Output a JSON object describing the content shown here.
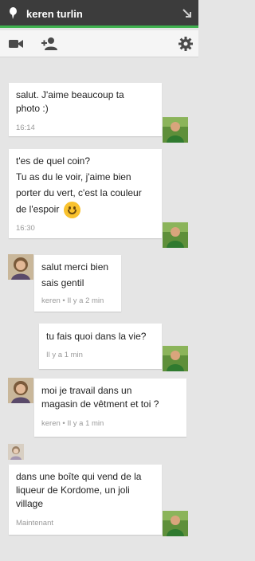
{
  "header": {
    "contact_name": "keren turlin"
  },
  "toolbar": {
    "video_icon": "video-camera-icon",
    "add_icon": "add-person-icon",
    "settings_icon": "gear-icon"
  },
  "colors": {
    "titlebar_bg": "#3c3c3c",
    "online_accent": "#3fb24f",
    "chat_bg": "#e5e5e5",
    "bubble_bg": "#ffffff",
    "meta_text": "#9a9a9a"
  },
  "messages": [
    {
      "from": "self",
      "lines": [
        "salut. J'aime beaucoup ta",
        "photo :)"
      ],
      "meta": "16:14"
    },
    {
      "from": "self",
      "lines": [
        "t'es de quel coin?",
        "Tu as du le voir, j'aime bien",
        "porter du vert, c'est la couleur",
        "de l'espoir"
      ],
      "meta": "16:30"
    },
    {
      "from": "keren",
      "lines": [
        "salut merci bien",
        "sais gentil"
      ],
      "meta": "keren • Il y a 2 min"
    },
    {
      "from": "self",
      "lines": [
        "tu fais quoi dans la vie?"
      ],
      "meta": "Il y a 1 min"
    },
    {
      "from": "keren",
      "lines": [
        "moi je travail dans un",
        "magasin de vêtment et toi ?"
      ],
      "meta": "keren • Il y a 1 min"
    },
    {
      "from": "self",
      "lines": [
        "dans une boîte qui vend de la",
        "liqueur de Kordome, un joli",
        "village"
      ],
      "meta": "Maintenant"
    }
  ]
}
